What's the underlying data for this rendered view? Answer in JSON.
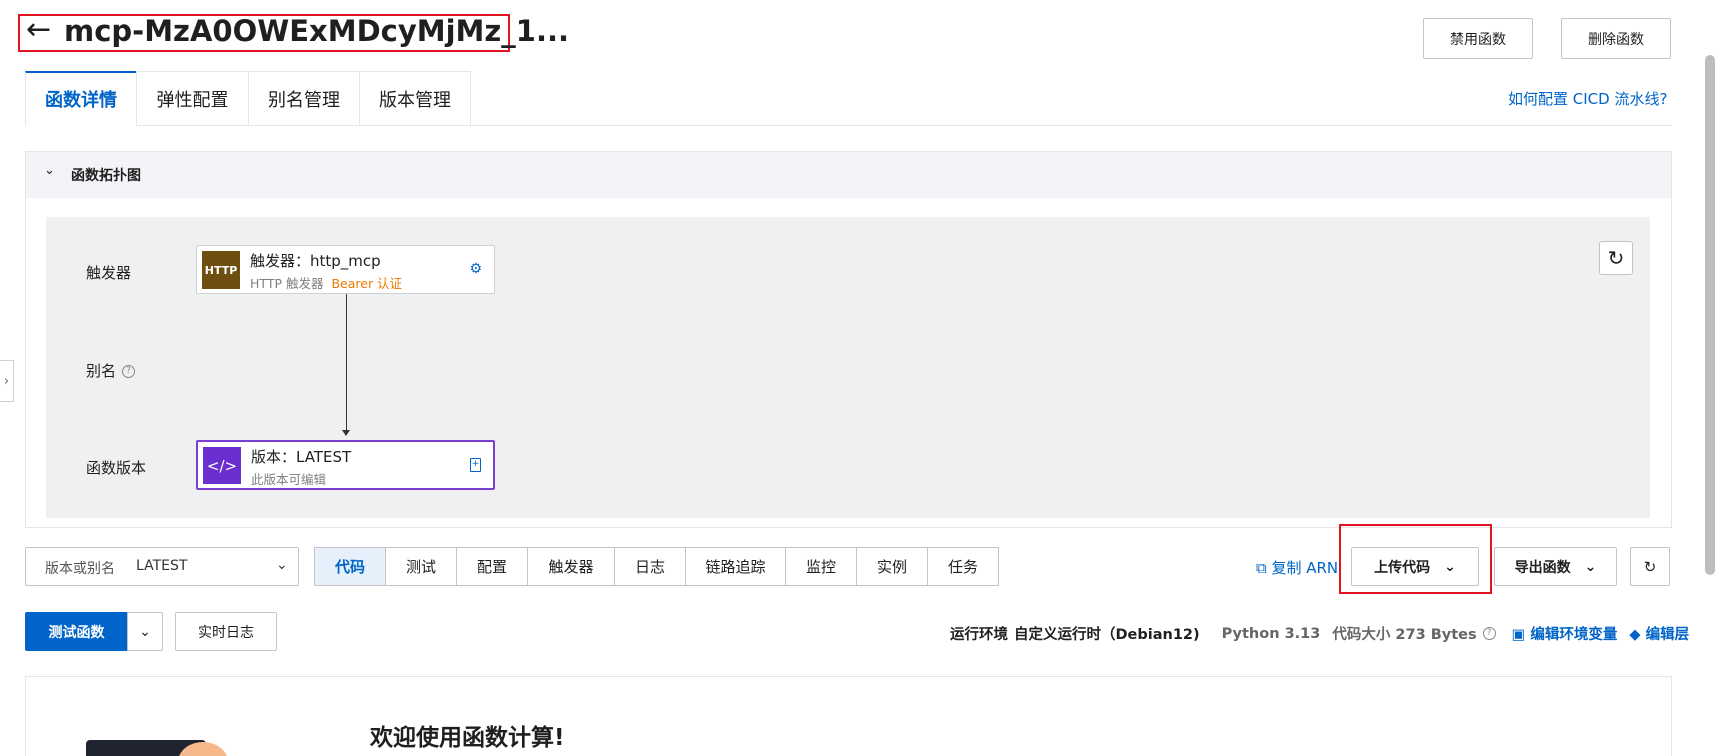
{
  "header": {
    "back_icon": "arrow-left-icon",
    "title": "mcp-MzA0OWExMDcyMjMz_1...",
    "disable_button": "禁用函数",
    "delete_button": "删除函数"
  },
  "tabs": [
    {
      "label": "函数详情"
    },
    {
      "label": "弹性配置"
    },
    {
      "label": "别名管理"
    },
    {
      "label": "版本管理"
    }
  ],
  "cicd_link": "如何配置 CICD 流水线?",
  "topology": {
    "title": "函数拓扑图",
    "rows": {
      "trigger": "触发器",
      "alias": "别名",
      "version": "函数版本"
    },
    "trigger_node": {
      "badge": "HTTP",
      "title": "触发器：http_mcp",
      "subtitle": "HTTP 触发器",
      "auth": "Bearer 认证"
    },
    "version_node": {
      "badge": "</>",
      "title": "版本：LATEST",
      "subtitle": "此版本可编辑"
    }
  },
  "toolbar": {
    "version_label": "版本或别名",
    "version_value": "LATEST",
    "segments": [
      "代码",
      "测试",
      "配置",
      "触发器",
      "日志",
      "链路追踪",
      "监控",
      "实例",
      "任务"
    ],
    "active_segment": "代码",
    "copy_arn": "复制 ARN",
    "upload_code": "上传代码",
    "export_function": "导出函数"
  },
  "actions": {
    "test_function": "测试函数",
    "realtime_log": "实时日志"
  },
  "env_info": {
    "runtime_label": "运行环境",
    "runtime_value": "自定义运行时（Debian12)",
    "python_version": "Python 3.13",
    "code_size": "代码大小 273 Bytes",
    "edit_env": "编辑环境变量",
    "edit_layer": "编辑层"
  },
  "welcome": {
    "title": "欢迎使用函数计算!"
  },
  "colors": {
    "primary": "#0064c8",
    "highlight_border": "#e1151f",
    "http_badge": "#6f4f10",
    "version_badge": "#6b2fd0",
    "auth_orange": "#f07800"
  }
}
